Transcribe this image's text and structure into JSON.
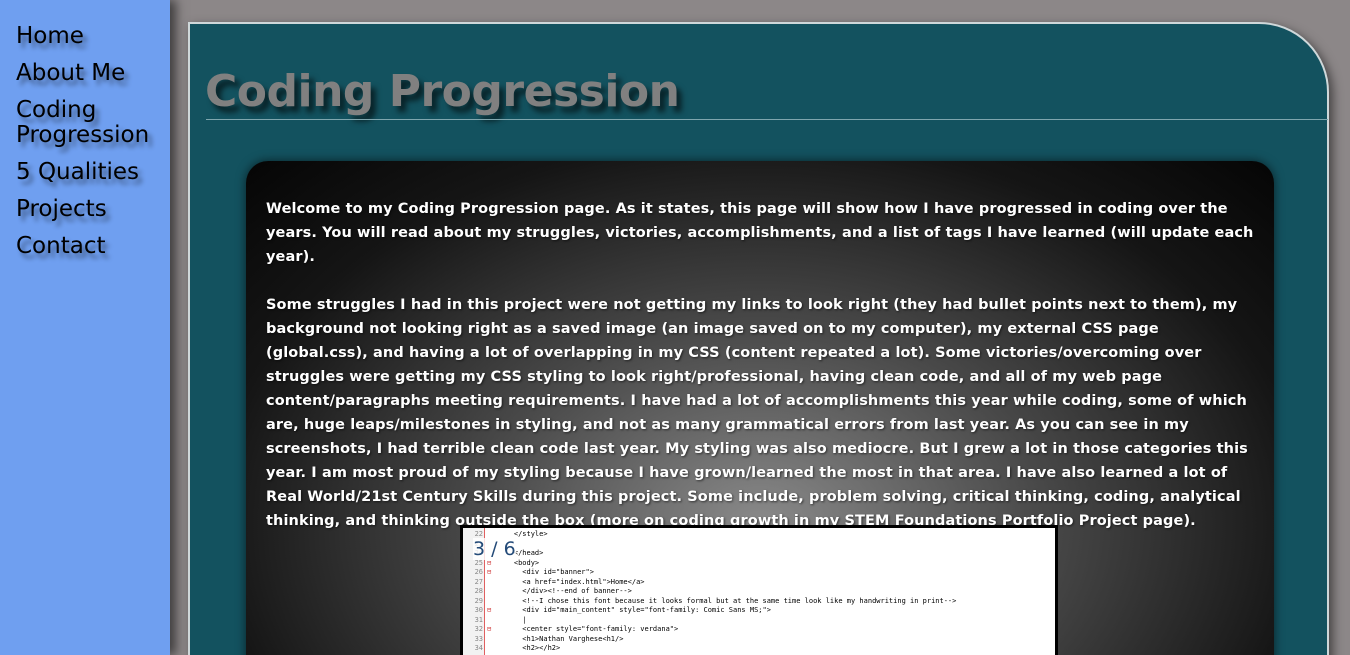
{
  "nav": {
    "items": [
      {
        "label": "Home",
        "name": "nav-home"
      },
      {
        "label": "About Me",
        "name": "nav-about-me"
      },
      {
        "label": "Coding Progression",
        "name": "nav-coding-progression"
      },
      {
        "label": "5 Qualities",
        "name": "nav-5-qualities"
      },
      {
        "label": "Projects",
        "name": "nav-projects"
      },
      {
        "label": "Contact",
        "name": "nav-contact"
      }
    ]
  },
  "page": {
    "title": "Coding Progression",
    "intro": "Welcome to my Coding Progression page. As it states, this page will show how I have progressed in coding over the years. You will read about my struggles, victories, accomplishments, and a list of tags I have learned (will update each year).",
    "body": "Some struggles I had in this project were not getting my links to look right (they had bullet points next to them), my background not looking right as a saved image (an image saved on to my computer), my external CSS page (global.css), and having a lot of overlapping in my CSS (content repeated a lot). Some victories/overcoming over struggles were getting my CSS styling to look right/professional, having clean code, and all of my web page content/paragraphs meeting requirements. I have had a lot of accomplishments this year while coding, some of which are, huge leaps/milestones in styling, and not as many grammatical errors from last year. As you can see in my screenshots, I had terrible clean code last year. My styling was also mediocre. But I grew a lot in those categories this year. I am most proud of my styling because I have grown/learned the most in that area. I have also learned a lot of Real World/21st Century Skills during this project. Some include, problem solving, critical thinking, coding, analytical thinking, and thinking outside the box (more on coding growth in my STEM Foundations Portfolio Project page)."
  },
  "slideshow": {
    "counter": "3 / 6",
    "code_lines": [
      {
        "ln": "22",
        "fold": "",
        "code": "    </style>"
      },
      {
        "ln": "23",
        "fold": "",
        "code": ""
      },
      {
        "ln": "24",
        "fold": "",
        "code": "    </head>"
      },
      {
        "ln": "25",
        "fold": "⊟",
        "code": "    <body>"
      },
      {
        "ln": "26",
        "fold": "⊟",
        "code": "      <div id=\"banner\">"
      },
      {
        "ln": "27",
        "fold": "",
        "code": "      <a href=\"index.html\">Home</a>"
      },
      {
        "ln": "28",
        "fold": "",
        "code": "      </div><!--end of banner-->"
      },
      {
        "ln": "29",
        "fold": "",
        "code": "      <!--I chose this font because it looks formal but at the same time look like my handwriting in print-->"
      },
      {
        "ln": "30",
        "fold": "⊟",
        "code": "      <div id=\"main_content\" style=\"font-family: Comic Sans MS;\">"
      },
      {
        "ln": "31",
        "fold": "",
        "code": "      |"
      },
      {
        "ln": "32",
        "fold": "⊟",
        "code": "      <center style=\"font-family: verdana\">"
      },
      {
        "ln": "33",
        "fold": "",
        "code": "      <h1>Nathan Varghese<h1/>"
      },
      {
        "ln": "34",
        "fold": "",
        "code": "      <h2></h2>"
      }
    ]
  }
}
